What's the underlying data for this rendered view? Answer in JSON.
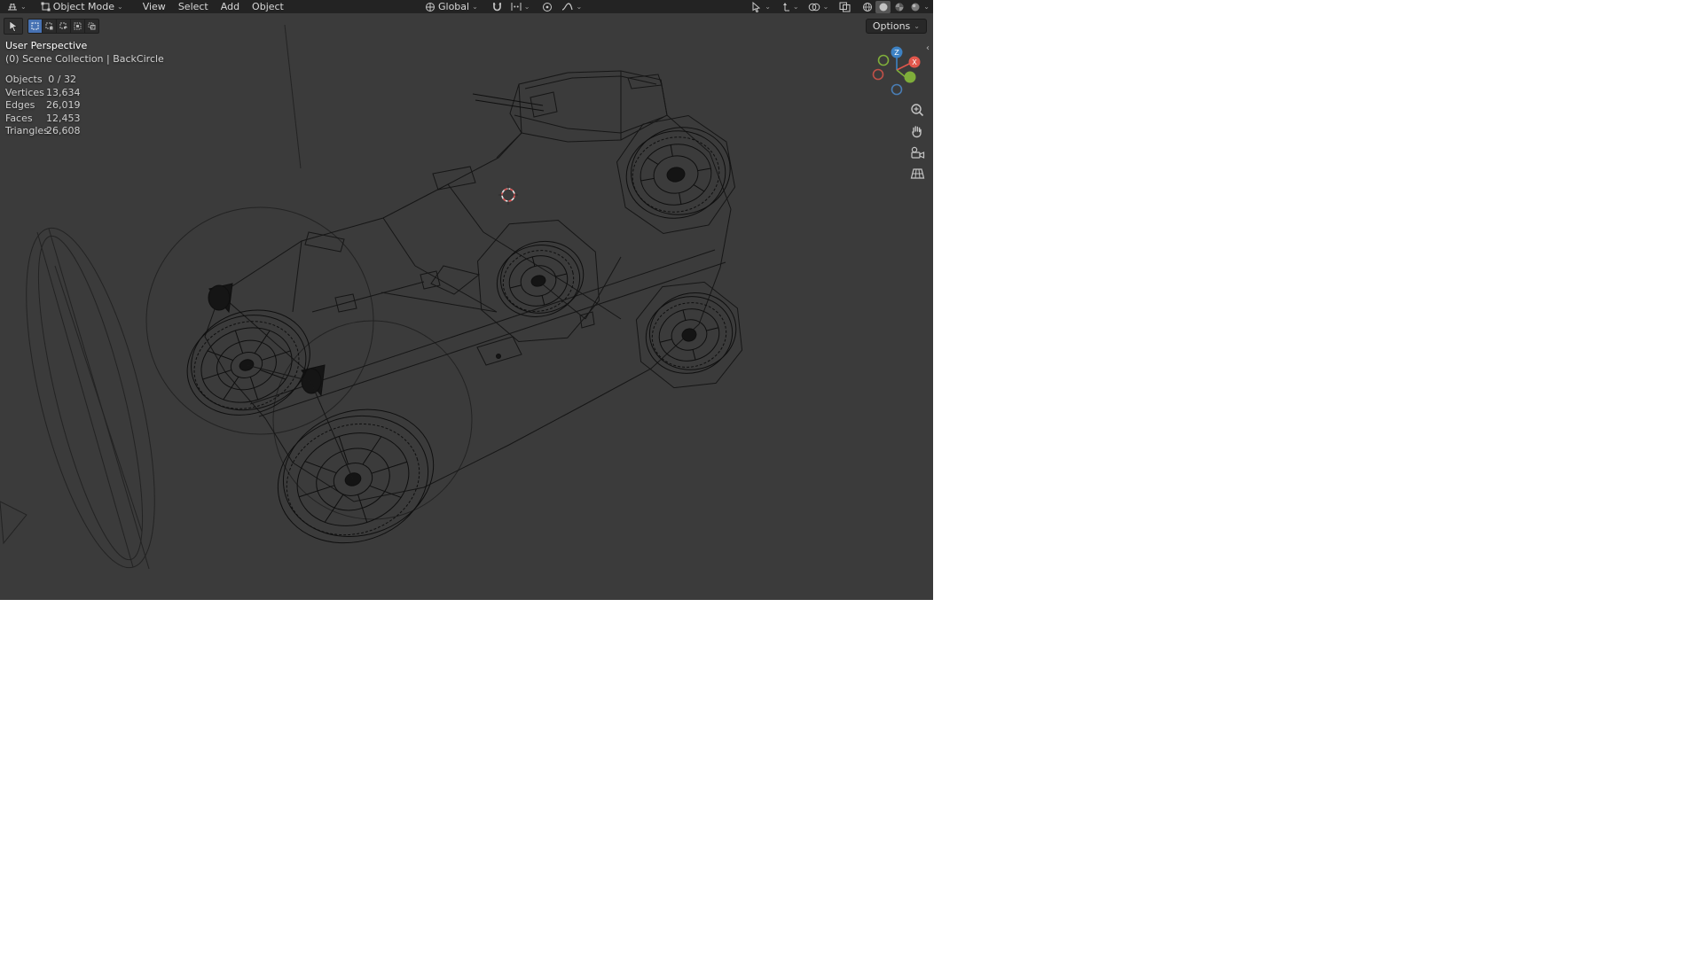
{
  "header": {
    "mode_label": "Object Mode",
    "menus": [
      {
        "label": "View"
      },
      {
        "label": "Select"
      },
      {
        "label": "Add"
      },
      {
        "label": "Object"
      }
    ],
    "orientation_label": "Global",
    "options_label": "Options"
  },
  "viewport": {
    "perspective_label": "User Perspective",
    "collection_label": "(0) Scene Collection | BackCircle",
    "stats": [
      {
        "label": "Objects",
        "value": "0 / 32"
      },
      {
        "label": "Vertices",
        "value": "13,634"
      },
      {
        "label": "Edges",
        "value": "26,019"
      },
      {
        "label": "Faces",
        "value": "12,453"
      },
      {
        "label": "Triangles",
        "value": "26,608"
      }
    ]
  },
  "gizmo": {
    "z_label": "Z",
    "x_label": "X"
  },
  "icons": {
    "caret": "⌄",
    "sidebar_collapse": "‹"
  },
  "colors": {
    "viewport_bg": "#3b3b3b",
    "header_bg": "#232323",
    "accent_active": "#4772b3",
    "axis_x": "#e2574c",
    "axis_y": "#7fae3a",
    "axis_z": "#3d82c4",
    "cursor_red": "#d84a4a",
    "wireframe": "#161616"
  }
}
